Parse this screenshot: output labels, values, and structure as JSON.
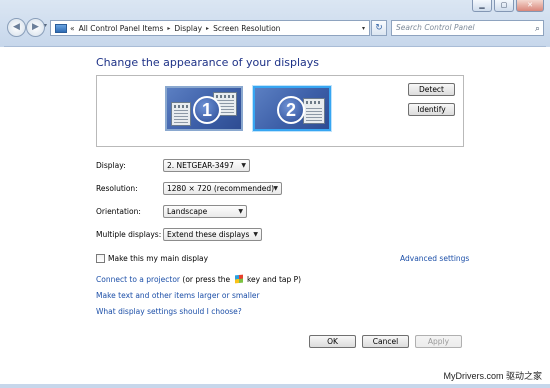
{
  "window": {
    "minimize": "▁",
    "maximize": "▢",
    "close": "✕"
  },
  "nav": {
    "back": "◀",
    "forward": "▶",
    "recent_pages": "▾"
  },
  "address": {
    "prefix": "«",
    "crumbs": [
      "All Control Panel Items",
      "Display",
      "Screen Resolution"
    ],
    "separator": "▸",
    "dropdown": "▾",
    "refresh": "↻"
  },
  "search": {
    "placeholder": "Search Control Panel",
    "icon": "⌕"
  },
  "page": {
    "heading": "Change the appearance of your displays"
  },
  "monitors": [
    {
      "number": "1",
      "selected": false
    },
    {
      "number": "2",
      "selected": true
    }
  ],
  "buttons": {
    "detect": "Detect",
    "identify": "Identify",
    "ok": "OK",
    "cancel": "Cancel",
    "apply": "Apply"
  },
  "fields": {
    "display": {
      "label": "Display:",
      "value": "2. NETGEAR-3497"
    },
    "resolution": {
      "label": "Resolution:",
      "value": "1280 × 720 (recommended)"
    },
    "orientation": {
      "label": "Orientation:",
      "value": "Landscape"
    },
    "multiple": {
      "label": "Multiple displays:",
      "value": "Extend these displays"
    },
    "dropdown_arrow": "▼"
  },
  "main_display": {
    "label": "Make this my main display",
    "checked": false
  },
  "links": {
    "advanced": "Advanced settings",
    "projector": "Connect to a projector",
    "projector_suffix_1": "(or press the",
    "projector_suffix_2": "key and tap P)",
    "text_size": "Make text and other items larger or smaller",
    "help": "What display settings should I choose?"
  },
  "watermark": "MyDrivers.com 驱动之家",
  "colors": {
    "heading": "#1e3287",
    "link": "#1c4fa8",
    "selected_monitor_border": "#37a6f2"
  }
}
